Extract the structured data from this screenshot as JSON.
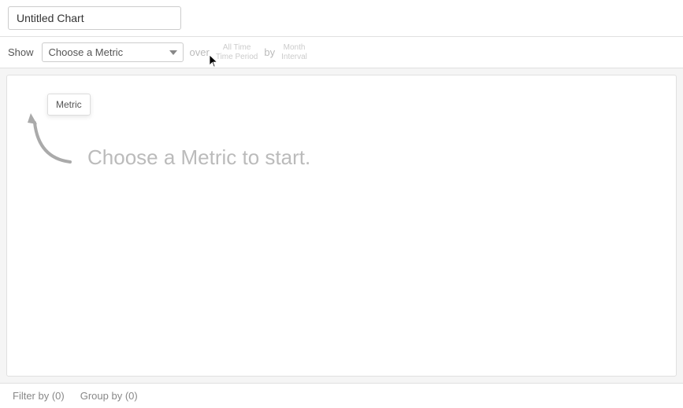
{
  "header": {
    "title_placeholder": "Untitled Chart",
    "title_value": "Untitled Chart"
  },
  "controls": {
    "show_label": "Show",
    "metric_placeholder": "Choose a Metric",
    "over_label": "over",
    "time_period_label": "All Time",
    "time_period_sublabel": "Time Period",
    "by_label": "by",
    "interval_label": "Month",
    "interval_sublabel": "Interval",
    "dropdown_hint": "Metric"
  },
  "chart": {
    "empty_message": "Choose a Metric to start."
  },
  "footer": {
    "filter_label": "Filter by (0)",
    "group_by_label": "Group by (0)"
  }
}
